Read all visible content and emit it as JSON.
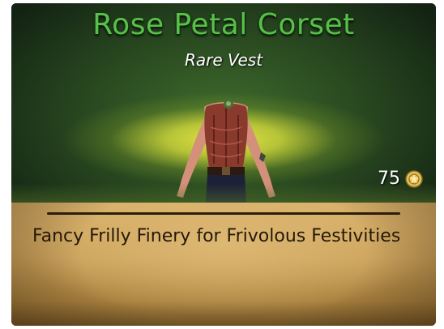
{
  "item": {
    "name": "Rose Petal Corset",
    "type": "Rare Vest",
    "price": "75",
    "description": "Fancy Frilly Finery for Frivolous Festivities"
  },
  "icons": {
    "currency": "gold-coin-icon",
    "preview": "corset-wearing-figure"
  },
  "colors": {
    "title": "#58c048",
    "subtitle": "#ffffff",
    "description": "#241808",
    "parchment": "#c9a05a",
    "glow": "#ecec46"
  }
}
